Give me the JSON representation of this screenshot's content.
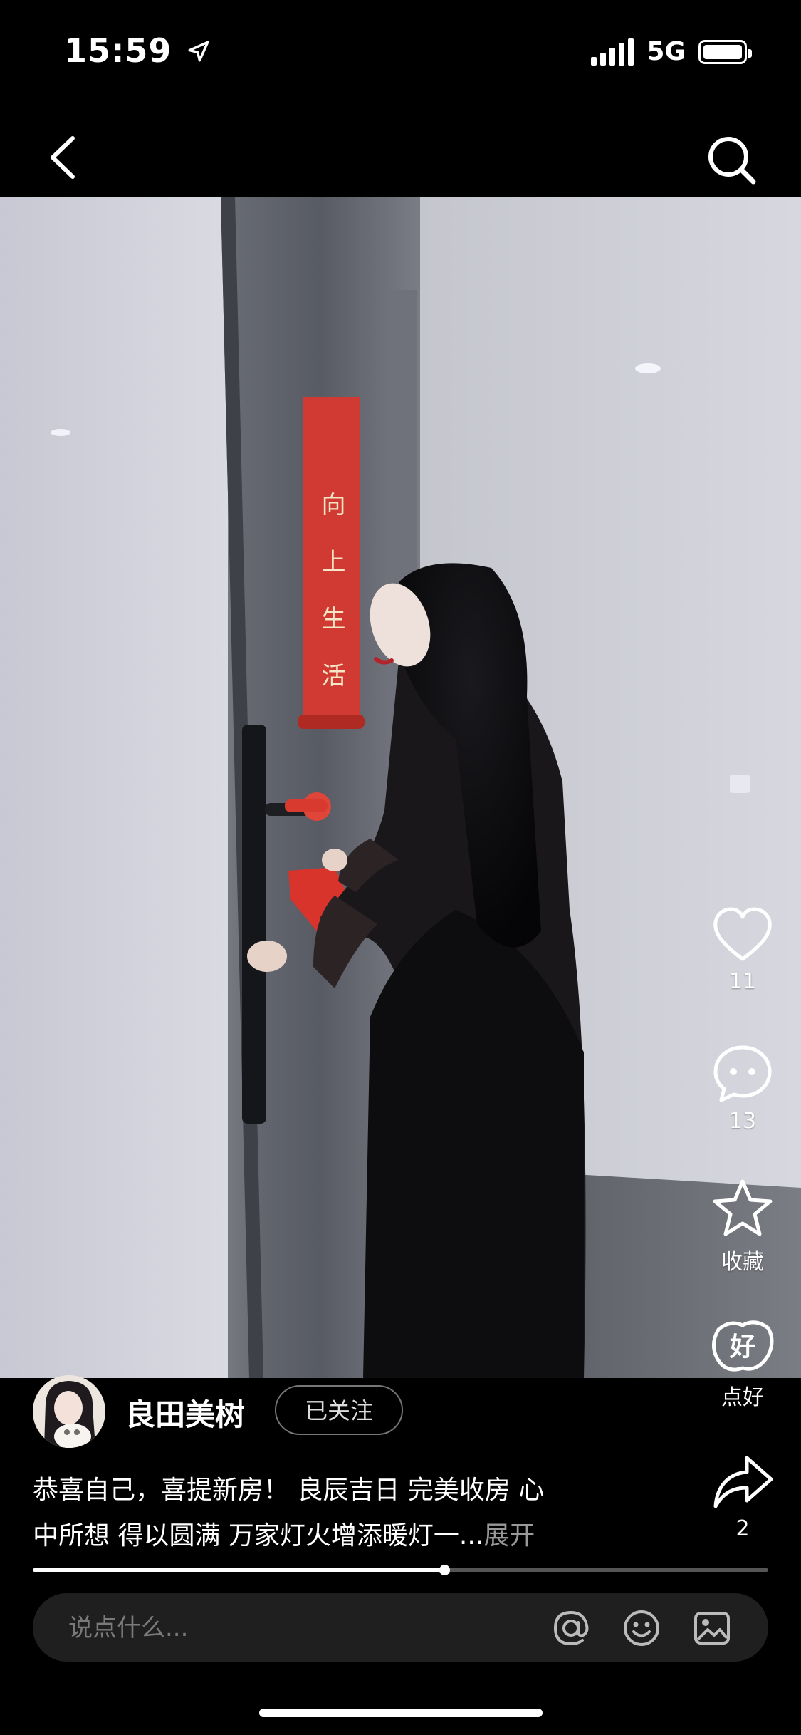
{
  "status_bar": {
    "time": "15:59",
    "network": "5G"
  },
  "nav": {
    "back_icon": "chevron-left-icon",
    "search_icon": "search-icon"
  },
  "video": {
    "banner_text": "向上生活"
  },
  "actions": {
    "like": {
      "icon": "heart-icon",
      "label": "11"
    },
    "comment": {
      "icon": "comment-bubble-icon",
      "label": "13"
    },
    "favorite": {
      "icon": "star-icon",
      "label": "收藏"
    },
    "good": {
      "icon": "good-badge-icon",
      "label": "点好"
    },
    "share": {
      "icon": "share-arrow-icon",
      "label": "2"
    }
  },
  "author": {
    "name": "良田美树",
    "follow_label": "已关注"
  },
  "caption": {
    "line1": "恭喜自己，喜提新房！ 良辰吉日   完美收房 心",
    "line2": "中所想   得以圆满 万家灯火增添暖灯一...",
    "more": "展开"
  },
  "progress": {
    "fraction": 0.56
  },
  "comment_bar": {
    "placeholder": "说点什么..."
  },
  "colors": {
    "background": "#000000",
    "accent_red": "#d8342c"
  }
}
